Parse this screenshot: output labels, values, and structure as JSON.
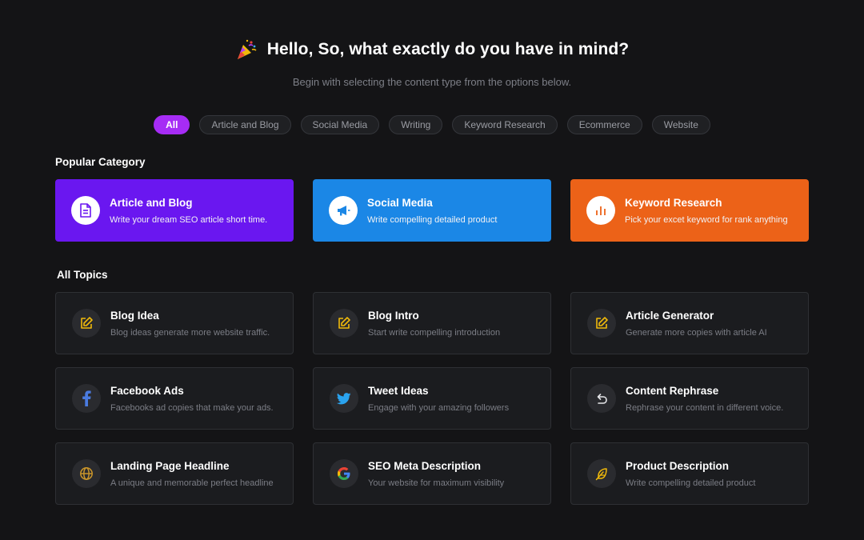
{
  "hero": {
    "title": "Hello, So, what exactly do you have in mind?",
    "subtitle": "Begin with selecting the content type from the options below.",
    "icon": "party-popper-icon"
  },
  "filters": [
    {
      "label": "All",
      "active": true
    },
    {
      "label": "Article and  Blog",
      "active": false
    },
    {
      "label": "Social Media",
      "active": false
    },
    {
      "label": "Writing",
      "active": false
    },
    {
      "label": "Keyword Research",
      "active": false
    },
    {
      "label": "Ecommerce",
      "active": false
    },
    {
      "label": "Website",
      "active": false
    }
  ],
  "popular": {
    "heading": "Popular Category",
    "cards": [
      {
        "title": "Article and Blog",
        "desc": "Write your dream SEO article short time.",
        "icon": "document-icon",
        "color": "#6a17f0"
      },
      {
        "title": "Social Media",
        "desc": "Write compelling detailed product",
        "icon": "megaphone-icon",
        "color": "#1b87e6"
      },
      {
        "title": "Keyword Research",
        "desc": "Pick your excet keyword for rank anything",
        "icon": "bar-chart-icon",
        "color": "#ec6218"
      }
    ]
  },
  "topics": {
    "heading": "All Topics",
    "cards": [
      {
        "title": "Blog Idea",
        "desc": "Blog ideas generate more website traffic.",
        "icon": "edit-icon"
      },
      {
        "title": "Blog Intro",
        "desc": "Start write compelling introduction",
        "icon": "edit-icon"
      },
      {
        "title": "Article Generator",
        "desc": "Generate more copies with article AI",
        "icon": "edit-icon"
      },
      {
        "title": "Facebook Ads",
        "desc": "Facebooks ad copies that make your ads.",
        "icon": "facebook-icon"
      },
      {
        "title": "Tweet Ideas",
        "desc": "Engage with your amazing followers",
        "icon": "twitter-icon"
      },
      {
        "title": "Content Rephrase",
        "desc": "Rephrase your content in different voice.",
        "icon": "undo-icon"
      },
      {
        "title": "Landing Page Headline",
        "desc": "A unique and memorable perfect headline",
        "icon": "globe-icon"
      },
      {
        "title": "SEO Meta Description",
        "desc": "Your website for maximum visibility",
        "icon": "google-icon"
      },
      {
        "title": "Product Description",
        "desc": "Write compelling detailed product",
        "icon": "feather-icon"
      }
    ]
  },
  "colors": {
    "background": "#141416",
    "active_chip": "#a62cf5",
    "icon_accent": "#f0b90b"
  }
}
